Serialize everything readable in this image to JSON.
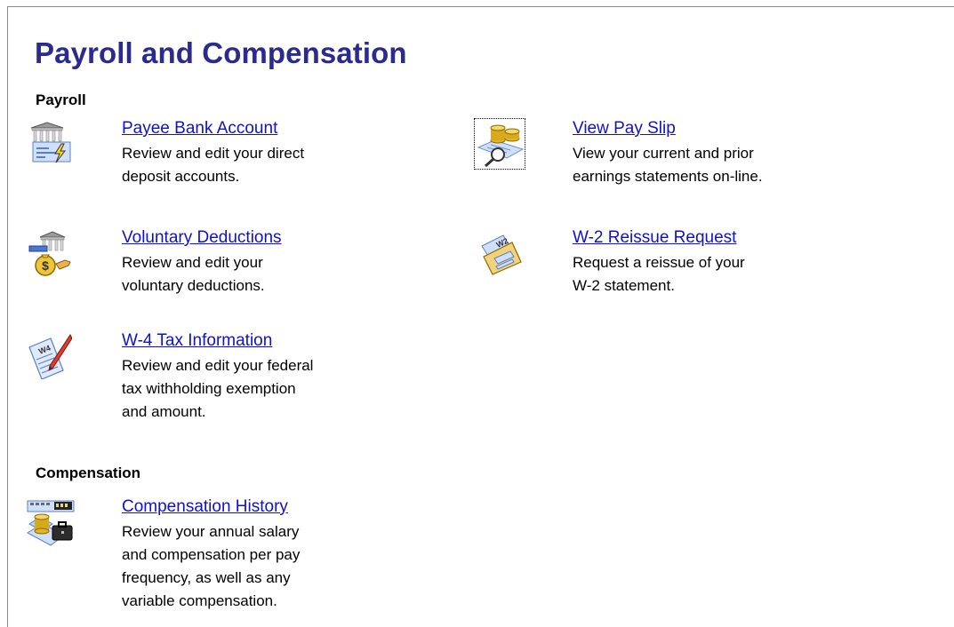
{
  "page": {
    "title": "Payroll and Compensation"
  },
  "sections": {
    "payroll": {
      "heading": "Payroll",
      "items": [
        {
          "icon": "bank-check-icon",
          "link": "Payee Bank Account",
          "description": "Review and edit your direct\ndeposit accounts."
        },
        {
          "icon": "coins-magnifier-icon",
          "link": "View Pay Slip",
          "description": "View your current and prior\nearnings statements on-line."
        },
        {
          "icon": "money-bag-hand-icon",
          "link": "Voluntary Deductions",
          "description": "Review and edit your\nvoluntary deductions."
        },
        {
          "icon": "w2-envelope-icon",
          "link": "W-2 Reissue Request",
          "description": "Request a reissue of your\nW-2 statement."
        },
        {
          "icon": "w4-form-pencil-icon",
          "link": "W-4 Tax Information",
          "description": "Review and edit your federal\ntax withholding exemption\nand amount."
        }
      ]
    },
    "compensation": {
      "heading": "Compensation",
      "items": [
        {
          "icon": "compensation-history-icon",
          "link": "Compensation History",
          "description": "Review your annual salary\nand compensation per pay\nfrequency, as well as any\nvariable compensation."
        }
      ]
    }
  },
  "colors": {
    "title": "#2b2b8f",
    "link": "#1111cc",
    "text": "#000000",
    "background": "#ffffff"
  }
}
